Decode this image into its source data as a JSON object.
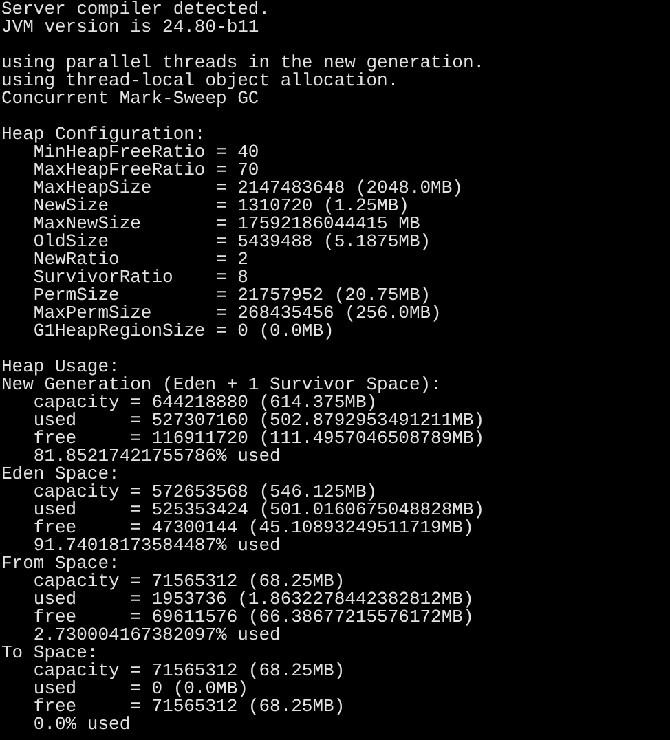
{
  "terminal": {
    "blocks": [
      [
        "Server compiler detected.",
        "JVM version is 24.80-b11"
      ],
      [
        "using parallel threads in the new generation.",
        "using thread-local object allocation.",
        "Concurrent Mark-Sweep GC"
      ],
      [
        "Heap Configuration:",
        "   MinHeapFreeRatio = 40",
        "   MaxHeapFreeRatio = 70",
        "   MaxHeapSize      = 2147483648 (2048.0MB)",
        "   NewSize          = 1310720 (1.25MB)",
        "   MaxNewSize       = 17592186044415 MB",
        "   OldSize          = 5439488 (5.1875MB)",
        "   NewRatio         = 2",
        "   SurvivorRatio    = 8",
        "   PermSize         = 21757952 (20.75MB)",
        "   MaxPermSize      = 268435456 (256.0MB)",
        "   G1HeapRegionSize = 0 (0.0MB)"
      ],
      [
        "Heap Usage:",
        "New Generation (Eden + 1 Survivor Space):",
        "   capacity = 644218880 (614.375MB)",
        "   used     = 527307160 (502.8792953491211MB)",
        "   free     = 116911720 (111.4957046508789MB)",
        "   81.85217421755786% used",
        "Eden Space:",
        "   capacity = 572653568 (546.125MB)",
        "   used     = 525353424 (501.0160675048828MB)",
        "   free     = 47300144 (45.10893249511719MB)",
        "   91.74018173584487% used",
        "From Space:",
        "   capacity = 71565312 (68.25MB)",
        "   used     = 1953736 (1.8632278442382812MB)",
        "   free     = 69611576 (66.38677215576172MB)",
        "   2.730004167382097% used",
        "To Space:",
        "   capacity = 71565312 (68.25MB)",
        "   used     = 0 (0.0MB)",
        "   free     = 71565312 (68.25MB)",
        "   0.0% used"
      ]
    ]
  }
}
